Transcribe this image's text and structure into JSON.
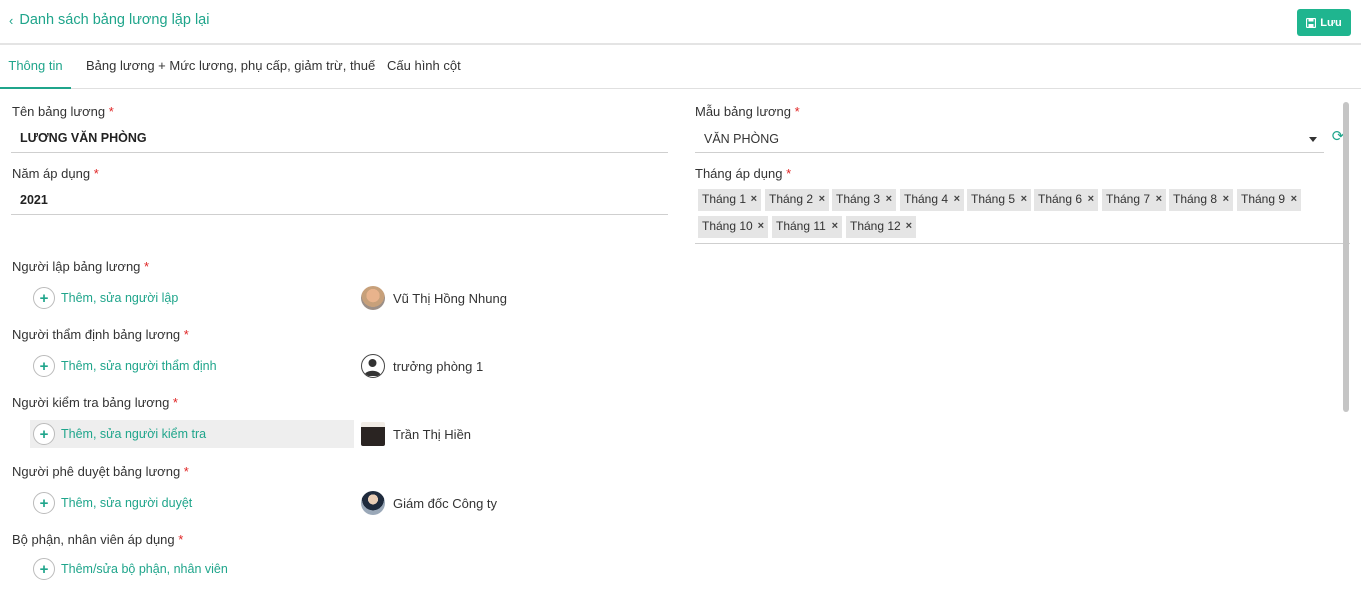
{
  "header": {
    "back_label": "Danh sách bảng lương lặp lại",
    "save_label": "Lưu"
  },
  "tabs": [
    {
      "label": "Thông tin",
      "active": true
    },
    {
      "label": "Bảng lương + Mức lương, phụ cấp, giảm trừ, thuế",
      "active": false
    },
    {
      "label": "Cấu hình cột",
      "active": false
    }
  ],
  "form": {
    "name_label": "Tên bảng lương",
    "name_value": "LƯƠNG VĂN PHÒNG",
    "year_label": "Năm áp dụng",
    "year_value": "2021",
    "template_label": "Mẫu bảng lương",
    "template_value": "VĂN PHÒNG",
    "months_label": "Tháng áp dụng",
    "months": [
      "Tháng 1",
      "Tháng 2",
      "Tháng 3",
      "Tháng 4",
      "Tháng 5",
      "Tháng 6",
      "Tháng 7",
      "Tháng 8",
      "Tháng 9",
      "Tháng 10",
      "Tháng 11",
      "Tháng 12"
    ],
    "required_mark": "*"
  },
  "roles": {
    "creator": {
      "label": "Người lập bảng lương",
      "add_label": "Thêm, sửa người lập",
      "person": "Vũ Thị Hồng Nhung"
    },
    "appraiser": {
      "label": "Người thẩm định bảng lương",
      "add_label": "Thêm, sửa người thẩm định",
      "person": "trưởng phòng 1"
    },
    "checker": {
      "label": "Người kiểm tra bảng lương",
      "add_label": "Thêm, sửa người kiểm tra",
      "person": "Trần Thị Hiền"
    },
    "approver": {
      "label": "Người phê duyệt bảng lương",
      "add_label": "Thêm, sửa người duyệt",
      "person": "Giám đốc Công ty"
    },
    "scope": {
      "label": "Bộ phận, nhân viên áp dụng",
      "add_label": "Thêm/sửa bộ phận, nhân viên"
    }
  },
  "colors": {
    "accent": "#1fa58b",
    "button": "#1fb58f",
    "required": "#e02424"
  },
  "icons": {
    "back": "chevron-left-icon",
    "save": "floppy-disk-icon",
    "refresh": "refresh-icon",
    "add": "plus-icon",
    "remove": "close-icon"
  }
}
